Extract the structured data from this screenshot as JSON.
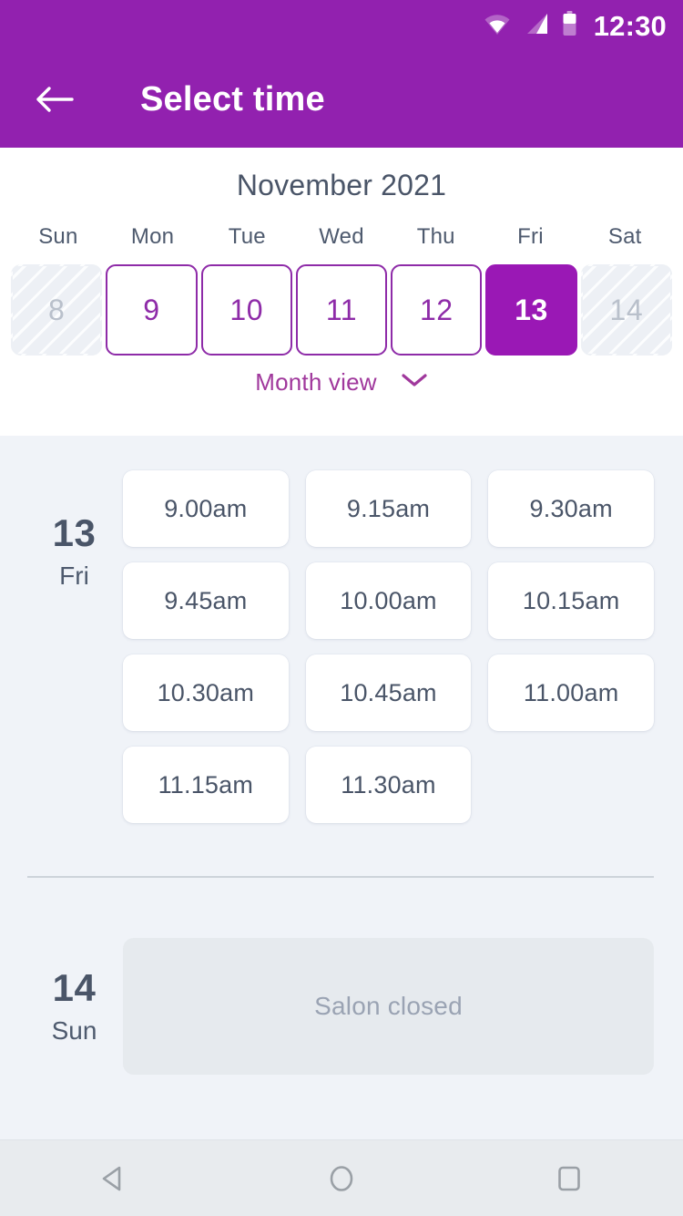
{
  "status_bar": {
    "time": "12:30",
    "icons": [
      "wifi-icon",
      "cellular-signal-icon",
      "battery-icon"
    ]
  },
  "app_bar": {
    "title": "Select time",
    "back_icon": "arrow-left-icon",
    "background_color": "#9221af",
    "text_color": "#ffffff"
  },
  "calendar": {
    "month_title": "November 2021",
    "weekdays": [
      "Sun",
      "Mon",
      "Tue",
      "Wed",
      "Thu",
      "Fri",
      "Sat"
    ],
    "days": [
      {
        "number": "8",
        "state": "disabled"
      },
      {
        "number": "9",
        "state": "available"
      },
      {
        "number": "10",
        "state": "available"
      },
      {
        "number": "11",
        "state": "available"
      },
      {
        "number": "12",
        "state": "available"
      },
      {
        "number": "13",
        "state": "selected"
      },
      {
        "number": "14",
        "state": "disabled"
      }
    ],
    "month_view_label": "Month view",
    "month_view_icon": "chevron-down-icon",
    "accent_color": "#9a18b5",
    "link_color": "#a0389c"
  },
  "schedule": [
    {
      "day_number": "13",
      "day_name": "Fri",
      "slots": [
        "9.00am",
        "9.15am",
        "9.30am",
        "9.45am",
        "10.00am",
        "10.15am",
        "10.30am",
        "10.45am",
        "11.00am",
        "11.15am",
        "11.30am"
      ]
    },
    {
      "day_number": "14",
      "day_name": "Sun",
      "closed_message": "Salon closed"
    }
  ],
  "nav_bar": {
    "back_label": "back-triangle-icon",
    "home_label": "home-circle-icon",
    "recents_label": "recents-square-icon"
  }
}
